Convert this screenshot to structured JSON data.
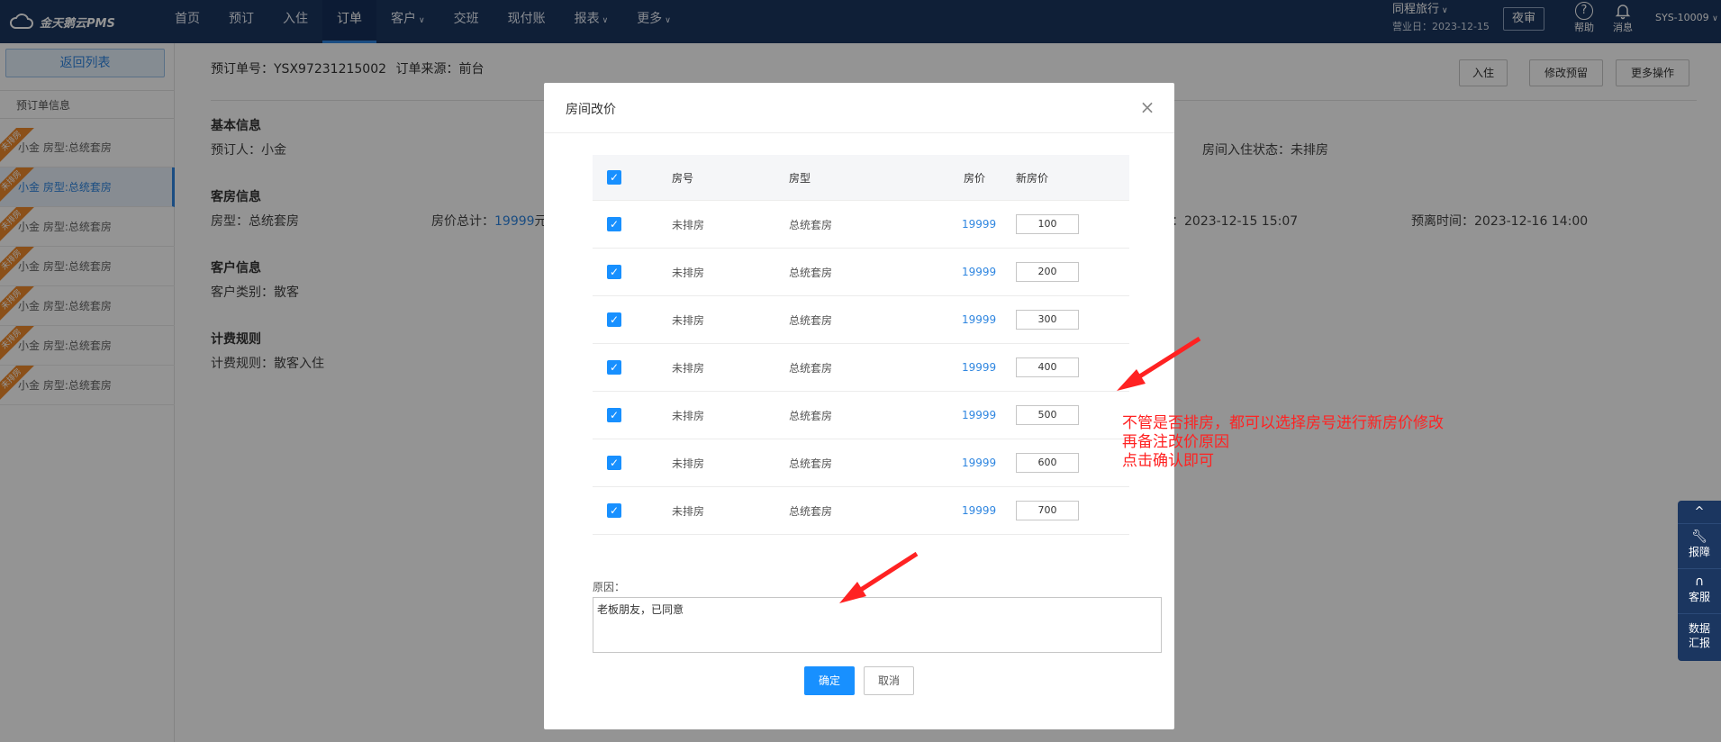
{
  "header": {
    "logo_text": "金天鹅云PMS",
    "nav": [
      {
        "label": "首页",
        "caret": false
      },
      {
        "label": "预订",
        "caret": false
      },
      {
        "label": "入住",
        "caret": false
      },
      {
        "label": "订单",
        "caret": false,
        "active": true
      },
      {
        "label": "客户",
        "caret": true
      },
      {
        "label": "交班",
        "caret": false
      },
      {
        "label": "现付账",
        "caret": false
      },
      {
        "label": "报表",
        "caret": true
      },
      {
        "label": "更多",
        "caret": true
      }
    ],
    "hotel_name": "同程旅行",
    "business_day": "营业日：2023-12-15",
    "night_audit": "夜审",
    "help": "帮助",
    "messages": "消息",
    "sys_id": "SYS-10009"
  },
  "left": {
    "back_button": "返回列表",
    "section_title": "预订单信息",
    "ribbon": "未排房",
    "items": [
      {
        "label": "小金 房型:总统套房",
        "active": false
      },
      {
        "label": "小金 房型:总统套房",
        "active": true
      },
      {
        "label": "小金 房型:总统套房",
        "active": false
      },
      {
        "label": "小金 房型:总统套房",
        "active": false
      },
      {
        "label": "小金 房型:总统套房",
        "active": false
      },
      {
        "label": "小金 房型:总统套房",
        "active": false
      },
      {
        "label": "小金 房型:总统套房",
        "active": false
      }
    ]
  },
  "main": {
    "order_no": "预订单号：YSX97231215002",
    "order_source": "订单来源：前台",
    "buttons": {
      "checkin": "入住",
      "modify": "修改预留",
      "more": "更多操作"
    },
    "basic_title": "基本信息",
    "booker": "预订人：小金",
    "checkin_status": "房间入住状态：未排房",
    "room_title": "客房信息",
    "room_type": "房型：总统套房",
    "price_total_label": "房价总计：",
    "price_total_value": "19999",
    "price_total_unit": "元",
    "arrive_time": "：2023-12-15 15:07",
    "leave_time": "预离时间：2023-12-16 14:00",
    "customer_title": "客户信息",
    "customer_type": "客户类别：散客",
    "billing_title": "计费规则",
    "billing_rule": "计费规则：散客入住"
  },
  "float_tools": {
    "up": "^",
    "report": "报障",
    "service": "客服",
    "data": "数据汇报"
  },
  "modal": {
    "title": "房间改价",
    "close": "×",
    "columns": {
      "room_no": "房号",
      "room_type": "房型",
      "price": "房价",
      "new_price": "新房价"
    },
    "rows": [
      {
        "room_no": "未排房",
        "room_type": "总统套房",
        "price": "19999",
        "new_price": "100"
      },
      {
        "room_no": "未排房",
        "room_type": "总统套房",
        "price": "19999",
        "new_price": "200"
      },
      {
        "room_no": "未排房",
        "room_type": "总统套房",
        "price": "19999",
        "new_price": "300"
      },
      {
        "room_no": "未排房",
        "room_type": "总统套房",
        "price": "19999",
        "new_price": "400"
      },
      {
        "room_no": "未排房",
        "room_type": "总统套房",
        "price": "19999",
        "new_price": "500"
      },
      {
        "room_no": "未排房",
        "room_type": "总统套房",
        "price": "19999",
        "new_price": "600"
      },
      {
        "room_no": "未排房",
        "room_type": "总统套房",
        "price": "19999",
        "new_price": "700"
      }
    ],
    "reason_label": "原因：",
    "reason_value": "老板朋友，已同意",
    "ok": "确定",
    "cancel": "取消"
  },
  "annotation": {
    "lines": [
      "不管是否排房，都可以选择房号进行新房价修改",
      "再备注改价原因",
      "点击确认即可"
    ],
    "color": "#ff2222"
  }
}
